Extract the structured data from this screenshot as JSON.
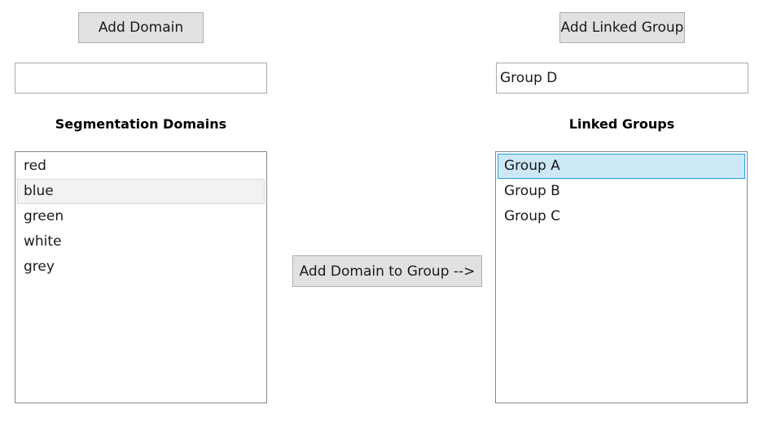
{
  "left": {
    "add_button_label": "Add Domain",
    "input_value": "",
    "heading": "Segmentation Domains",
    "items": [
      "red",
      "blue",
      "green",
      "white",
      "grey"
    ]
  },
  "middle": {
    "add_to_group_label": "Add Domain to Group -->"
  },
  "right": {
    "add_button_label": "Add Linked Group",
    "input_value": "Group D",
    "heading": "Linked Groups",
    "items": [
      "Group A",
      "Group B",
      "Group C"
    ]
  },
  "colors": {
    "selection_background": "#cce8f6",
    "selection_border": "#26a0da",
    "hover_background": "#f2f2f2"
  }
}
